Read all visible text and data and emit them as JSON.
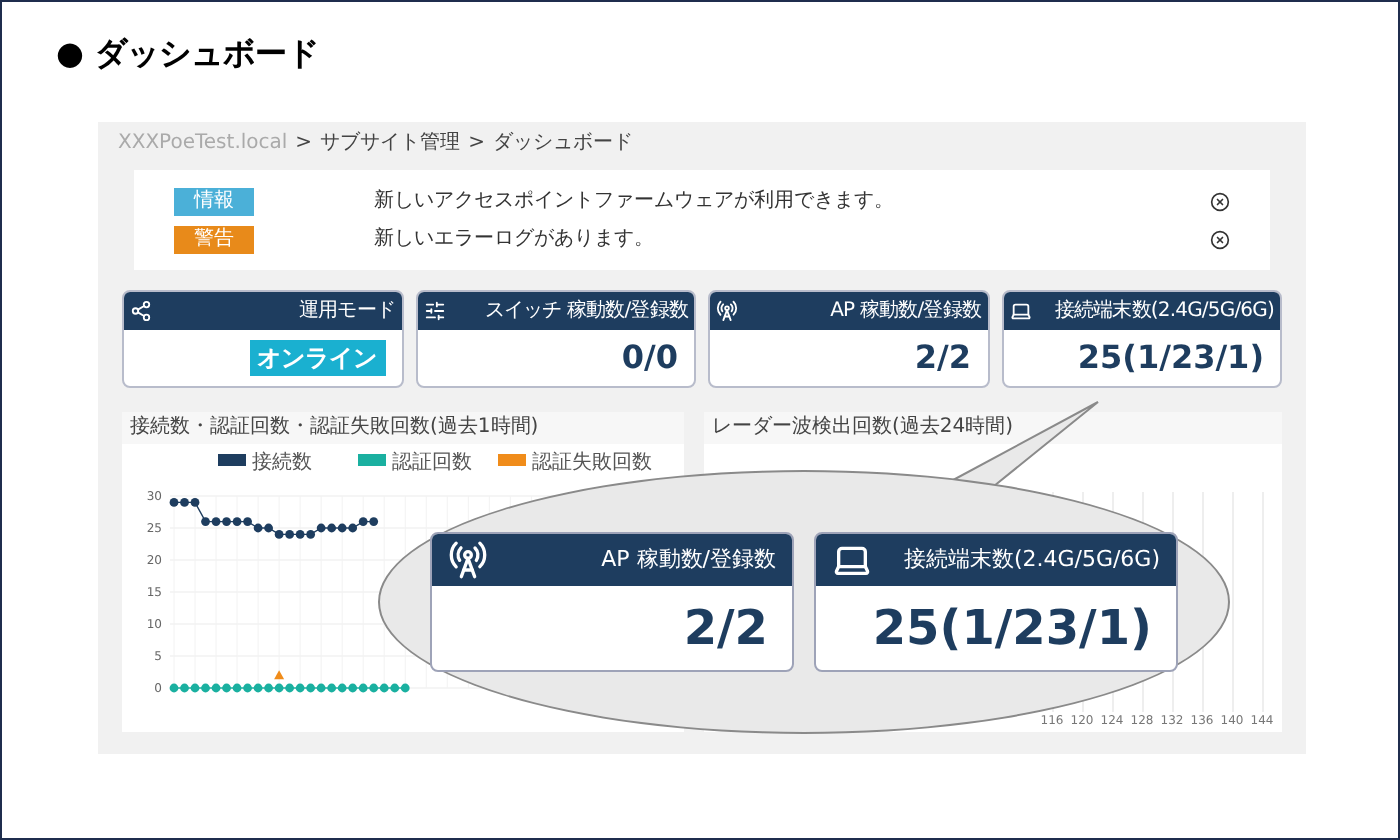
{
  "heading": "● ダッシュボード",
  "breadcrumb": [
    "XXXPoeTest.local",
    ">",
    "サブサイト管理",
    ">",
    "ダッシュボード"
  ],
  "notifications": [
    {
      "tag": "情報",
      "color": "#4bb0d8",
      "message": "新しいアクセスポイントファームウェアが利用できます。"
    },
    {
      "tag": "警告",
      "color": "#e88a1a",
      "message": "新しいエラーログがあります。"
    }
  ],
  "cards": [
    {
      "label": "運用モード",
      "kind": "status",
      "value": "オンライン"
    },
    {
      "label": "スイッチ 稼動数/登録数",
      "kind": "count",
      "value": "0/0"
    },
    {
      "label": "AP 稼動数/登録数",
      "kind": "count",
      "value": "2/2"
    },
    {
      "label": "接続端末数(2.4G/5G/6G)",
      "kind": "count",
      "value": "25(1/23/1)"
    }
  ],
  "connections_panel": {
    "title": "接続数・認証回数・認証失敗回数(過去1時間)",
    "chart_data": {
      "type": "line",
      "ylim": [
        0,
        30
      ],
      "yticks": [
        0,
        5,
        10,
        15,
        20,
        25,
        30
      ],
      "grid": true,
      "legend": "top",
      "series": [
        {
          "name": "接続数",
          "color": "#1e3d5f",
          "marker": "circle",
          "values": [
            29,
            29,
            29,
            26,
            26,
            26,
            26,
            26,
            25,
            25,
            24,
            24,
            24,
            24,
            25,
            25,
            25,
            25,
            26,
            26,
            null,
            null,
            null,
            null,
            null,
            null,
            null,
            null,
            null,
            null,
            null,
            null,
            null,
            null,
            null,
            null,
            null,
            null,
            null,
            null,
            null,
            null,
            null,
            null,
            null,
            null,
            null,
            null
          ]
        },
        {
          "name": "認証回数",
          "color": "#1ab0a0",
          "marker": "circle",
          "values": [
            0,
            0,
            0,
            0,
            0,
            0,
            0,
            0,
            0,
            0,
            0,
            0,
            0,
            0,
            0,
            0,
            0,
            0,
            0,
            0,
            0,
            0,
            0,
            null,
            null,
            null,
            null,
            null,
            null,
            null,
            null,
            null,
            null,
            null,
            null,
            null,
            null,
            null,
            null,
            null,
            null,
            null,
            null,
            null,
            null,
            null,
            null,
            null
          ]
        },
        {
          "name": "認証失敗回数",
          "color": "#f08c1a",
          "marker": "triangle",
          "values": [
            null,
            null,
            null,
            null,
            null,
            null,
            null,
            null,
            null,
            null,
            2,
            null,
            null,
            null,
            null,
            null,
            null,
            null,
            null,
            null,
            null,
            null,
            null,
            null,
            null,
            null,
            null,
            null,
            null,
            null,
            null,
            null,
            null,
            null,
            null,
            null,
            null,
            null,
            null,
            null,
            null,
            null,
            null,
            null,
            null,
            null,
            null,
            null
          ]
        }
      ]
    }
  },
  "radar_panel": {
    "title": "レーダー波検出回数(過去24時間)",
    "x_ticks": [
      "116",
      "120",
      "124",
      "128",
      "132",
      "136",
      "140",
      "144"
    ]
  },
  "callout": {
    "cards": [
      {
        "label": "AP 稼動数/登録数",
        "value": "2/2"
      },
      {
        "label": "接続端末数(2.4G/5G/6G)",
        "value": "25(1/23/1)"
      }
    ]
  }
}
